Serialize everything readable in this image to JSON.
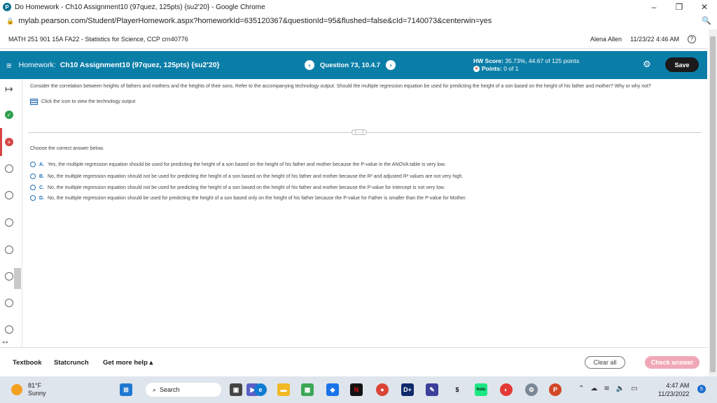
{
  "browser": {
    "window_title": "Do Homework - Ch10 Assignment10 (97quez, 125pts) {su2'20} - Google Chrome",
    "url": "mylab.pearson.com/Student/PlayerHomework.aspx?homeworkId=635120367&questionId=95&flushed=false&cId=7140073&centerwin=yes"
  },
  "course": {
    "name": "MATH 251 901 15A FA22 - Statistics for Science, CCP crn40776",
    "user": "Alena Allen",
    "datetime": "11/23/22 4:46 AM",
    "help": "?"
  },
  "homework": {
    "label": "Homework:",
    "title": "Ch10 Assignment10 (97quez, 125pts) {su2'20}",
    "question": "Question 73, 10.4.7",
    "score_label": "HW Score:",
    "score_value": "35.73%, 44.67 of 125 points",
    "points_label": "Points:",
    "points_value": "0 of 1",
    "save": "Save"
  },
  "question": {
    "prompt": "Consider the correlation between heights of fathers and mothers and the heights of their sons. Refer to the accompanying technology output. Should the multiple regression equation be used for predicting the height of a son based on the height of his father and mother? Why or why not?",
    "tech_link": "Click the icon to view the technology output",
    "more": "(.....)",
    "instruction": "Choose the correct answer below.",
    "options": [
      {
        "letter": "A.",
        "text": "Yes, the multiple regression equation should be used for predicting the height of a son based on the height of his father and mother because the P-value in the ANOVA table is very low."
      },
      {
        "letter": "B.",
        "text": "No, the multiple regression equation should not be used for predicting the height of a son based on the height of his father and mother because the R² and adjusted R² values are not very high."
      },
      {
        "letter": "C.",
        "text": "No, the multiple regression equation should not be used for predicting the height of a son based on the height of his father and mother because the P-value for Intercept is not very low."
      },
      {
        "letter": "D.",
        "text": "No, the multiple regression equation should be used for predicting the height of a son based only on the height of his father because the P-value for Father is smaller than the P-value for Mother."
      }
    ]
  },
  "footer": {
    "textbook": "Textbook",
    "statcrunch": "Statcrunch",
    "help": "Get more help ▴",
    "clear": "Clear all",
    "check": "Check answer"
  },
  "taskbar": {
    "temp": "81°F",
    "condition": "Sunny",
    "search": "Search",
    "time": "4:47 AM",
    "date": "11/23/2022",
    "notifications": "5"
  },
  "colors": {
    "hw_bar": "#0b7ea8",
    "correct": "#2e9e4a",
    "incorrect": "#d64545",
    "check_button": "#f0a8b6"
  }
}
